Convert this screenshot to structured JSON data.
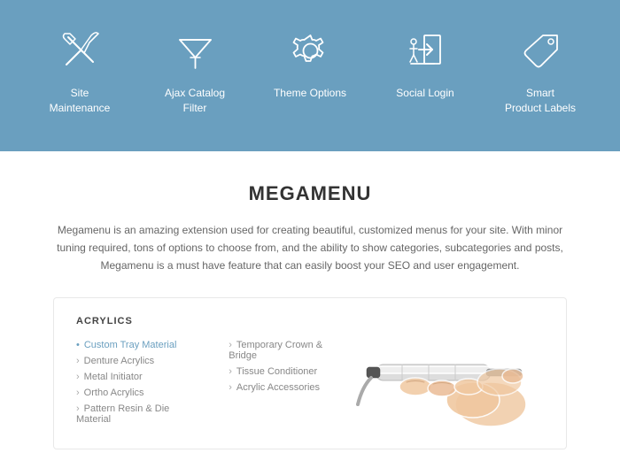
{
  "blue_section": {
    "icons": [
      {
        "id": "site-maintenance",
        "label": "Site\nMaintenance",
        "icon_type": "wrench"
      },
      {
        "id": "ajax-catalog-filter",
        "label": "Ajax Catalog\nFilter",
        "icon_type": "filter"
      },
      {
        "id": "theme-options",
        "label": "Theme Options",
        "icon_type": "gear"
      },
      {
        "id": "social-login",
        "label": "Social Login",
        "icon_type": "door"
      },
      {
        "id": "smart-product-labels",
        "label": "Smart\nProduct Labels",
        "icon_type": "tag"
      }
    ]
  },
  "megamenu_section": {
    "title": "MEGAMENU",
    "description": "Megamenu is an amazing extension used for creating beautiful, customized menus for your site. With minor tuning required, tons of options to choose from, and the ability to show categories, subcategories and posts, Megamenu is a must have feature that can easily boost your SEO and user engagement.",
    "demo": {
      "category": "ACRYLICS",
      "column1": [
        {
          "text": "Custom Tray Material",
          "highlighted": true
        },
        {
          "text": "Denture Acrylics",
          "highlighted": false
        },
        {
          "text": "Metal Initiator",
          "highlighted": false
        },
        {
          "text": "Ortho Acrylics",
          "highlighted": false
        },
        {
          "text": "Pattern Resin & Die Material",
          "highlighted": false
        }
      ],
      "column2": [
        {
          "text": "Temporary Crown & Bridge",
          "highlighted": false
        },
        {
          "text": "Tissue Conditioner",
          "highlighted": false
        },
        {
          "text": "Acrylic Accessories",
          "highlighted": false
        }
      ]
    }
  }
}
